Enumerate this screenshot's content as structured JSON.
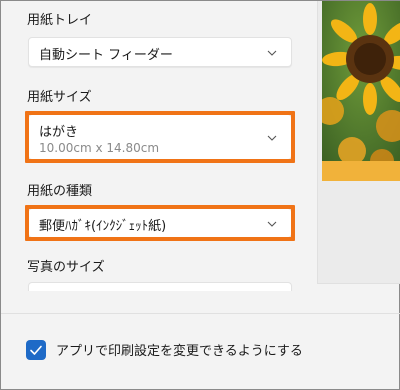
{
  "sections": {
    "tray": {
      "label": "用紙トレイ",
      "value": "自動シート フィーダー"
    },
    "size": {
      "label": "用紙サイズ",
      "value": "はがき",
      "detail": "10.00cm x 14.80cm"
    },
    "type": {
      "label": "用紙の種類",
      "value": "郵便ﾊｶﾞｷ(ｲﾝｸｼﾞｪｯﾄ紙)"
    },
    "photo_size": {
      "label": "写真のサイズ"
    }
  },
  "footer": {
    "checkbox_label": "アプリで印刷設定を変更できるようにする",
    "checkbox_checked": true
  },
  "colors": {
    "highlight": "#f07316",
    "accent": "#1e6ac7"
  },
  "icons": {
    "dropdown": "chevron-down-icon",
    "checkbox": "checkmark-icon"
  }
}
